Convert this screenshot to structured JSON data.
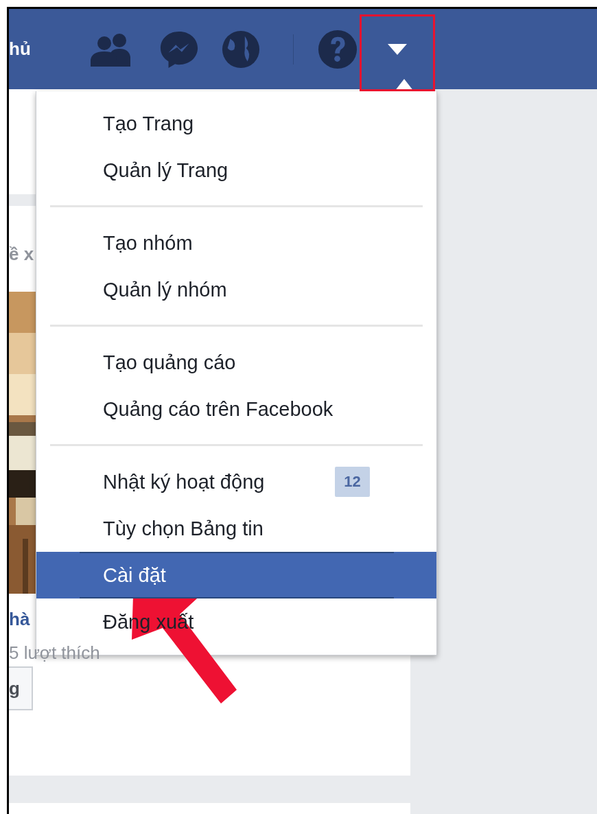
{
  "top_bar": {
    "home_label": "hủ",
    "dropdown_open": true
  },
  "post": {
    "title_fragment": "ề x",
    "page_name": "hà",
    "likes": "5 lượt thích",
    "button_label": "g"
  },
  "menu": {
    "groups": [
      {
        "items": [
          {
            "label": "Tạo Trang",
            "selected": false
          },
          {
            "label": "Quản lý Trang",
            "selected": false
          }
        ]
      },
      {
        "items": [
          {
            "label": "Tạo nhóm",
            "selected": false
          },
          {
            "label": "Quản lý nhóm",
            "selected": false
          }
        ]
      },
      {
        "items": [
          {
            "label": "Tạo quảng cáo",
            "selected": false
          },
          {
            "label": "Quảng cáo trên Facebook",
            "selected": false
          }
        ]
      },
      {
        "items": [
          {
            "label": "Nhật ký hoạt động",
            "selected": false,
            "badge": "12"
          },
          {
            "label": "Tùy chọn Bảng tin",
            "selected": false
          },
          {
            "label": "Cài đặt",
            "selected": true
          },
          {
            "label": "Đăng xuất",
            "selected": false
          }
        ]
      }
    ]
  },
  "annotations": {
    "highlight_box": true,
    "pointer_arrow": true
  }
}
